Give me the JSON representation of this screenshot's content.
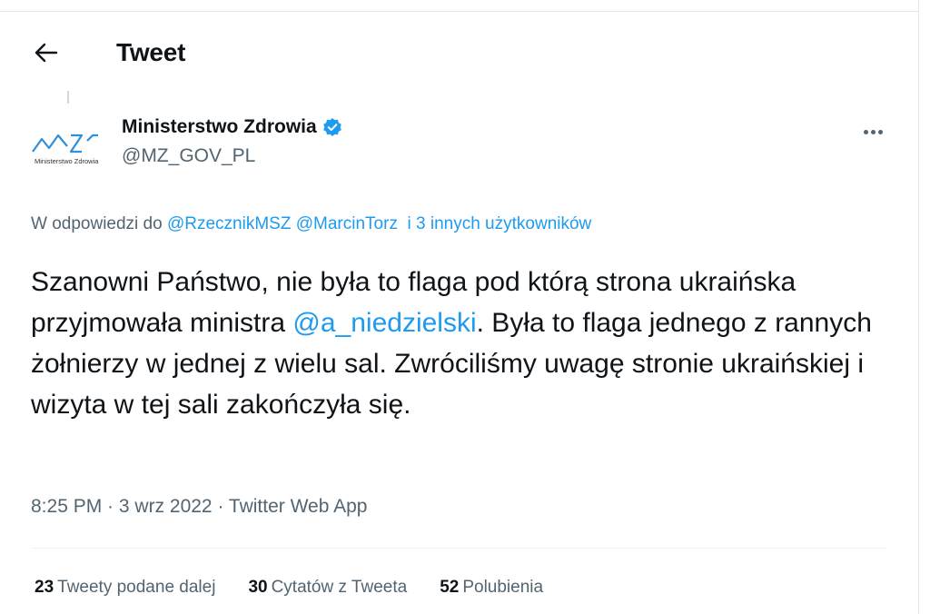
{
  "header": {
    "title": "Tweet"
  },
  "author": {
    "name": "Ministerstwo Zdrowia",
    "handle": "@MZ_GOV_PL",
    "logo_caption": "Ministerstwo Zdrowia",
    "verified_color": "#1d9bf0"
  },
  "reply": {
    "prefix": "W odpowiedzi do",
    "mention1": "@RzecznikMSZ",
    "mention2": "@MarcinTorz",
    "others": "i 3 innych użytkowników"
  },
  "tweet": {
    "text_before": "Szanowni Państwo, nie była to flaga pod którą strona ukraińska przyjmowała ministra ",
    "mention": "@a_niedzielski",
    "text_after": ". Była to flaga jednego z rannych żołnierzy w jednej z wielu sal. Zwróciliśmy uwagę stronie ukraińskiej i wizyta w tej sali zakończyła się."
  },
  "meta": {
    "time": "8:25 PM",
    "sep1": " · ",
    "date": "3 wrz 2022",
    "sep2": " · ",
    "source": "Twitter Web App"
  },
  "stats": {
    "retweets_count": "23",
    "retweets_label": "Tweety podane dalej",
    "quotes_count": "30",
    "quotes_label": "Cytatów z Tweeta",
    "likes_count": "52",
    "likes_label": "Polubienia"
  },
  "icons": {
    "back": "arrow-left-icon",
    "verified": "verified-badge-icon",
    "more": "more-horizontal-icon"
  }
}
